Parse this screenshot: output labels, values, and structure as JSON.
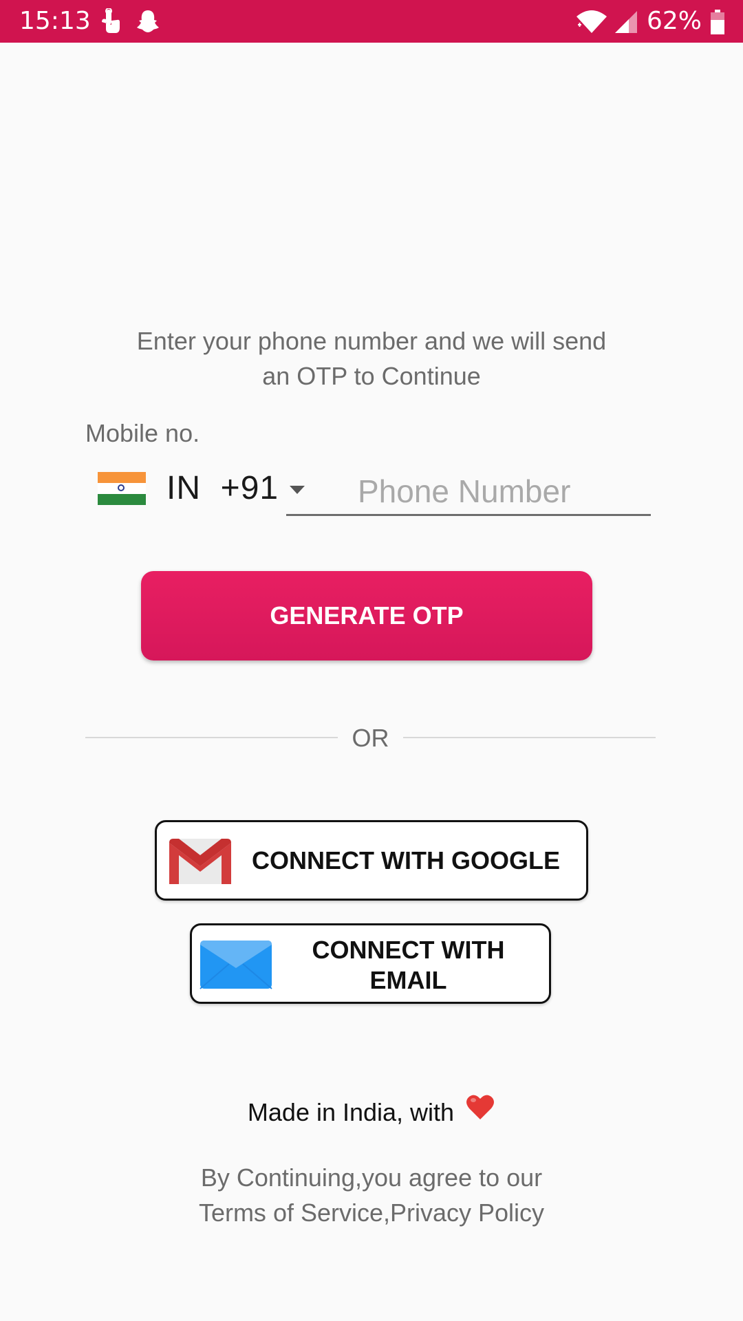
{
  "status_bar": {
    "time": "15:13",
    "battery": "62%",
    "icons": [
      "touch-icon",
      "snapchat-icon",
      "wifi-icon",
      "signal-icon",
      "battery-icon"
    ],
    "background_color": "#d0144f"
  },
  "intro": {
    "text": "Enter your phone number and we will send\nan OTP to Continue"
  },
  "mobile_form": {
    "label": "Mobile no.",
    "country": {
      "flag": "india-flag-icon",
      "code": "IN  +91"
    },
    "phone_placeholder": "Phone Number",
    "phone_value": ""
  },
  "generate_button": {
    "label": "GENERATE OTP",
    "color": "#e81f62"
  },
  "divider": {
    "label": "OR"
  },
  "social": {
    "google": {
      "label": "CONNECT WITH GOOGLE",
      "icon": "gmail-icon"
    },
    "email": {
      "label": "CONNECT WITH\nEMAIL",
      "icon": "envelope-icon"
    }
  },
  "footer": {
    "made_in": "Made in India, with",
    "heart_icon": "heart-icon",
    "terms": "By Continuing,you agree to our\nTerms of Service,Privacy Policy"
  }
}
